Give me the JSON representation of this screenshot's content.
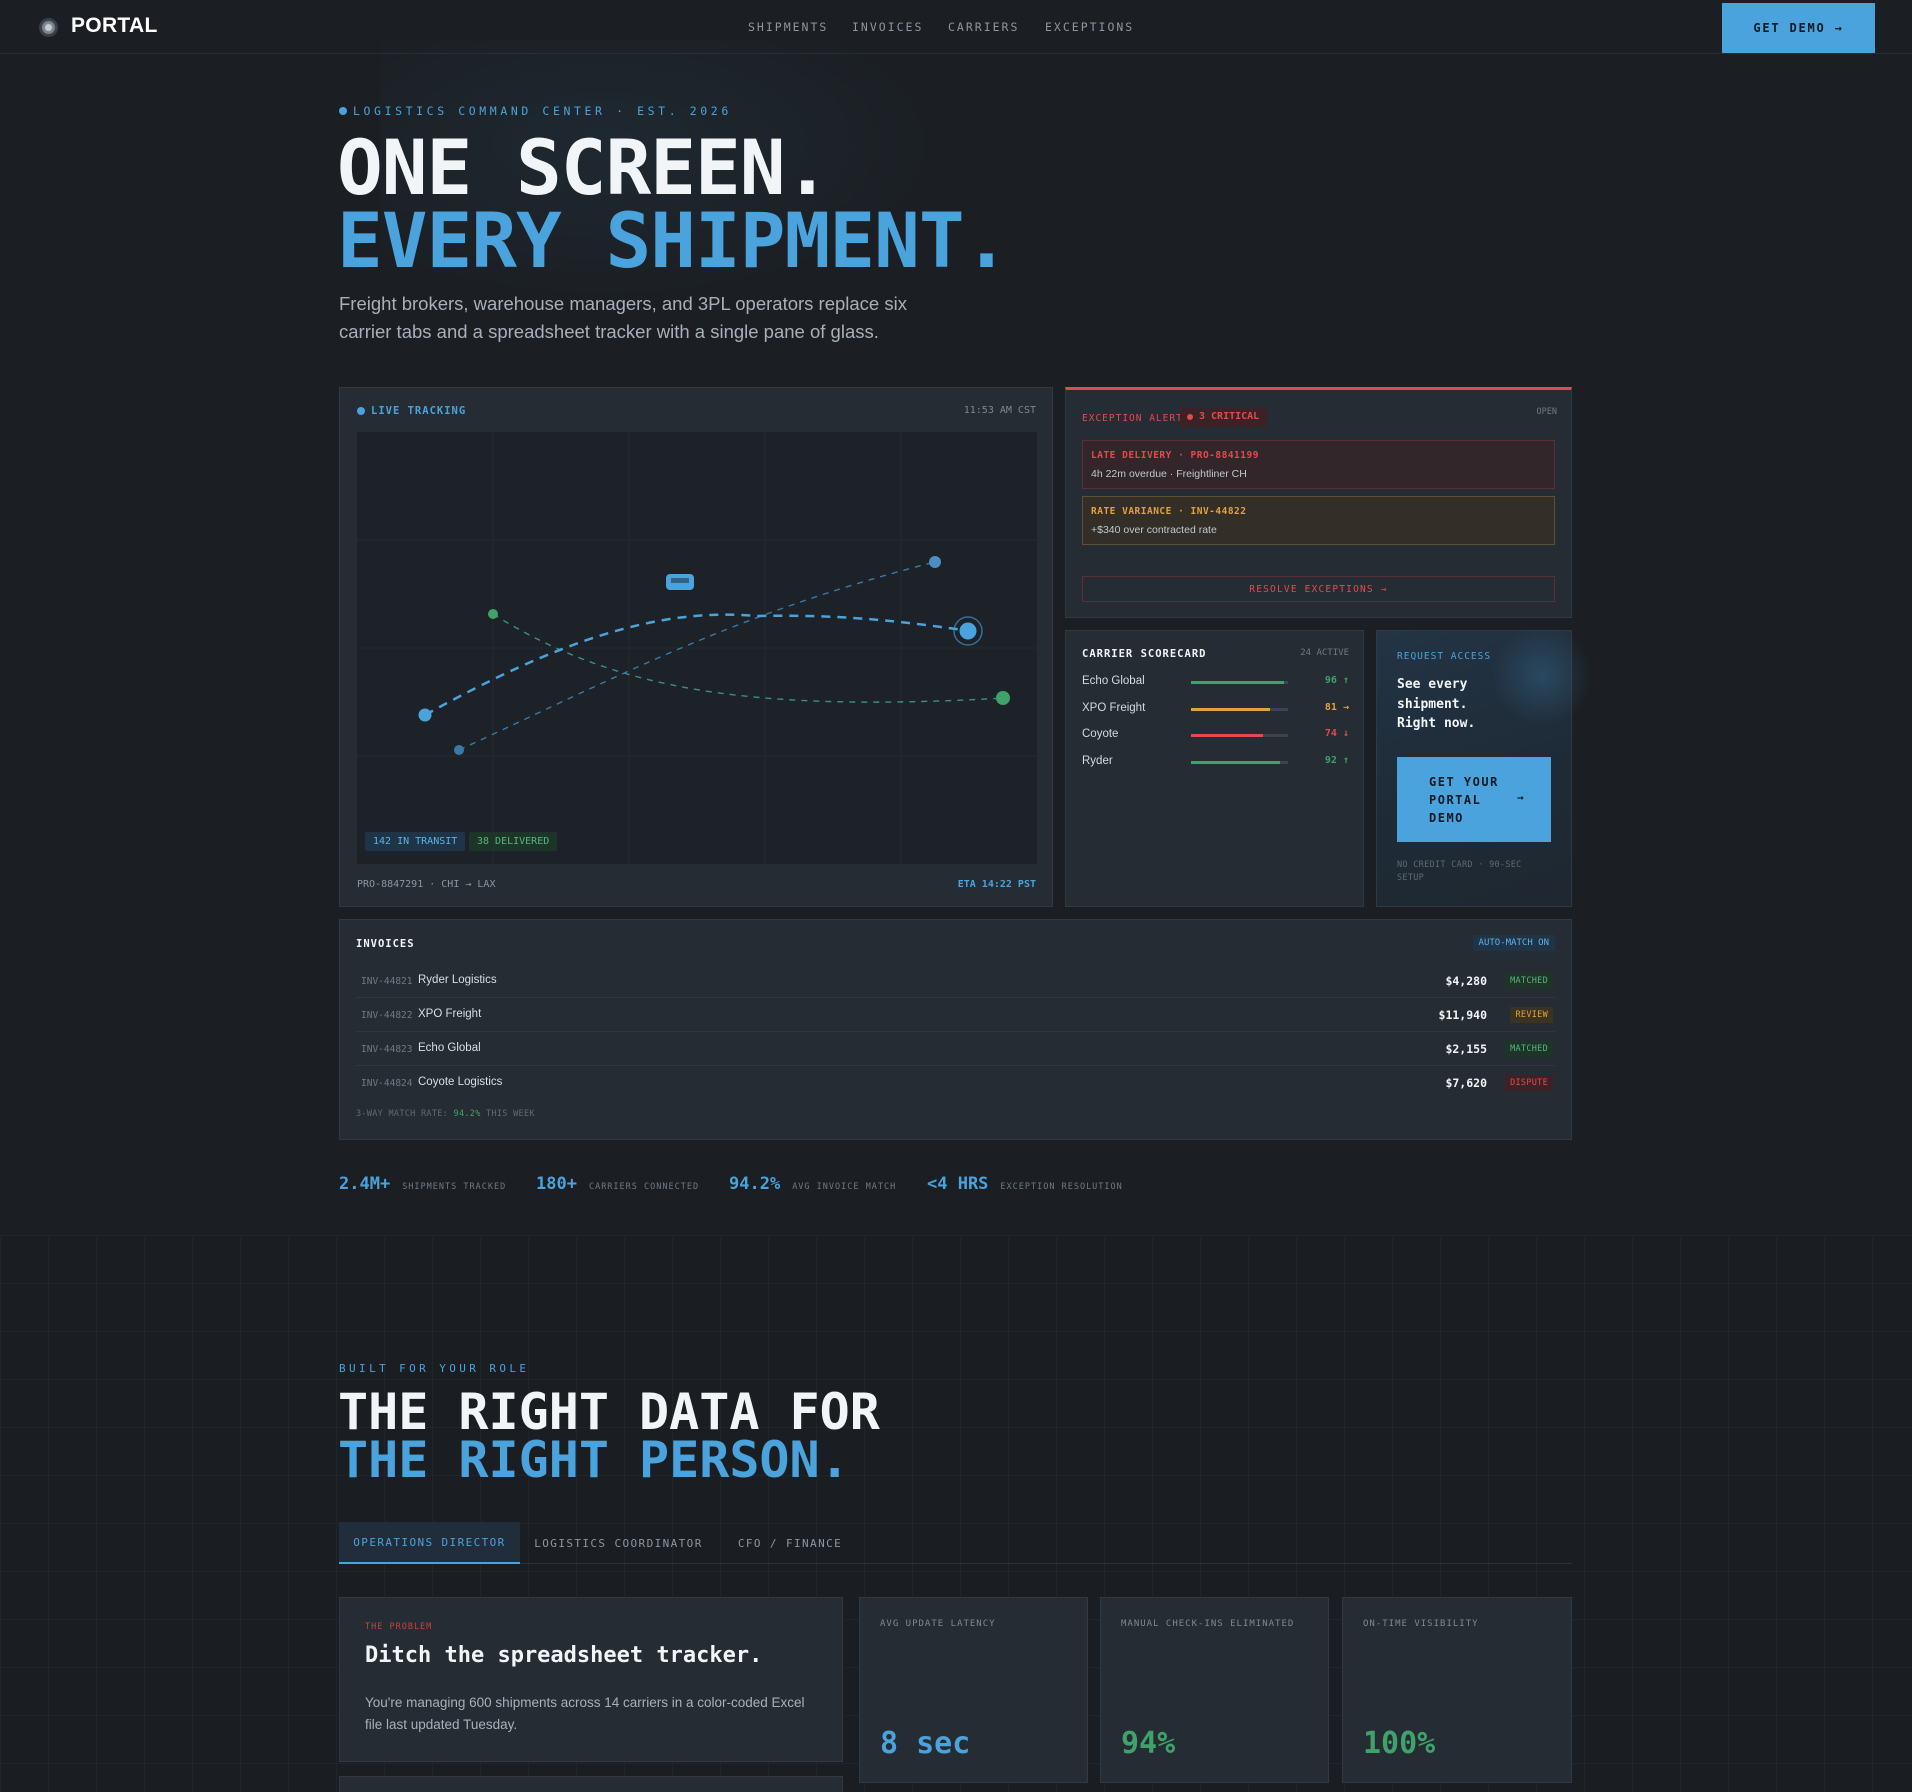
{
  "nav": {
    "brand": "PORTAL",
    "links": [
      "SHIPMENTS",
      "INVOICES",
      "CARRIERS",
      "EXCEPTIONS"
    ],
    "cta": "GET DEMO →"
  },
  "hero": {
    "eyebrow": "LOGISTICS COMMAND CENTER · EST. 2026",
    "title_line1": "ONE SCREEN.",
    "title_line2": "EVERY SHIPMENT.",
    "subtitle": "Freight brokers, warehouse managers, and 3PL operators replace six carrier tabs and a spreadsheet tracker with a single pane of glass."
  },
  "tracking": {
    "label": "LIVE TRACKING",
    "time": "11:53 AM CST",
    "in_transit": "142 IN TRANSIT",
    "delivered": "38 DELIVERED",
    "shipment": "PRO-8847291 · CHI → LAX",
    "eta": "ETA 14:22 PST"
  },
  "exceptions": {
    "label": "EXCEPTION ALERT",
    "critical": "3 CRITICAL",
    "status": "OPEN",
    "alerts": [
      {
        "title": "LATE DELIVERY · PRO-8841199",
        "detail": "4h 22m overdue · Freightliner CH"
      },
      {
        "title": "RATE VARIANCE · INV-44822",
        "detail": "+$340 over contracted rate"
      }
    ],
    "resolve": "RESOLVE EXCEPTIONS →"
  },
  "scorecard": {
    "label": "CARRIER SCORECARD",
    "active": "24 ACTIVE",
    "rows": [
      {
        "name": "Echo Global",
        "value": "96 ↑",
        "score": 96,
        "color": "#3ea36a"
      },
      {
        "name": "XPO Freight",
        "value": "81 →",
        "score": 81,
        "color": "#e2a23b"
      },
      {
        "name": "Coyote",
        "value": "74 ↓",
        "score": 74,
        "color": "#e24b4b"
      },
      {
        "name": "Ryder",
        "value": "92 ↑",
        "score": 92,
        "color": "#3ea36a"
      }
    ]
  },
  "request": {
    "label": "REQUEST ACCESS",
    "heading": [
      "See every",
      "shipment.",
      "Right now."
    ],
    "cta": [
      "GET YOUR",
      "PORTAL",
      "DEMO"
    ],
    "cta_arrow": "→",
    "note_line1": "NO CREDIT CARD · 90-SEC",
    "note_line2": "SETUP"
  },
  "invoices": {
    "label": "INVOICES",
    "badge": "AUTO-MATCH ON",
    "rows": [
      {
        "id": "INV-44821",
        "name": "Ryder Logistics",
        "amount": "$4,280",
        "status": "MATCHED"
      },
      {
        "id": "INV-44822",
        "name": "XPO Freight",
        "amount": "$11,940",
        "status": "REVIEW"
      },
      {
        "id": "INV-44823",
        "name": "Echo Global",
        "amount": "$2,155",
        "status": "MATCHED"
      },
      {
        "id": "INV-44824",
        "name": "Coyote Logistics",
        "amount": "$7,620",
        "status": "DISPUTE"
      }
    ],
    "footer_prefix": "3-WAY MATCH RATE:",
    "footer_value": "94.2%",
    "footer_suffix": "THIS WEEK"
  },
  "stats": [
    {
      "value": "2.4M+",
      "label": "SHIPMENTS TRACKED"
    },
    {
      "value": "180+",
      "label": "CARRIERS CONNECTED"
    },
    {
      "value": "94.2%",
      "label": "AVG INVOICE MATCH"
    },
    {
      "value": "<4 HRS",
      "label": "EXCEPTION RESOLUTION"
    }
  ],
  "roles": {
    "eyebrow": "BUILT FOR YOUR ROLE",
    "title_line1": "THE RIGHT DATA FOR",
    "title_line2": "THE RIGHT PERSON.",
    "tabs": [
      "OPERATIONS DIRECTOR",
      "LOGISTICS COORDINATOR",
      "CFO / FINANCE"
    ],
    "problem": {
      "kicker": "THE PROBLEM",
      "title": "Ditch the spreadsheet tracker.",
      "body": "You're managing 600 shipments across 14 carriers in a color-coded Excel file last updated Tuesday."
    },
    "kpis": [
      {
        "label": "AVG UPDATE LATENCY",
        "value": "8 sec",
        "color": "#4aa3dc"
      },
      {
        "label": "MANUAL CHECK-INS ELIMINATED",
        "value": "94%",
        "color": "#3ea36a"
      },
      {
        "label": "ON-TIME VISIBILITY",
        "value": "100%",
        "color": "#3ea36a"
      }
    ]
  },
  "colors": {
    "accent": "#4aa3dc",
    "success": "#3ea36a",
    "warning": "#e2a23b",
    "danger": "#e24b4b",
    "background": "#1b1f24"
  }
}
